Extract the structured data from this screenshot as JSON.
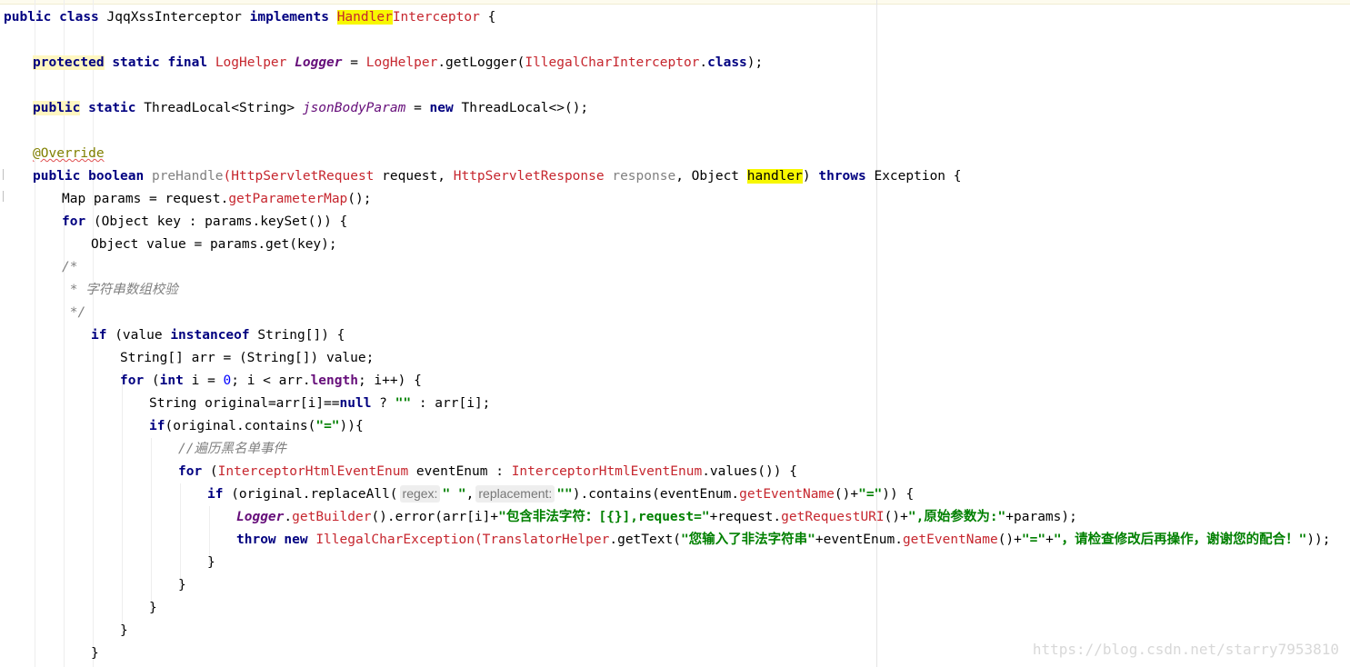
{
  "code": {
    "l1_public": "public",
    "l1_class": "class",
    "l1_classname": " JqqXssInterceptor ",
    "l1_implements": "implements",
    "l1_sp": " ",
    "l1_handler": "Handler",
    "l1_interceptor": "Interceptor",
    "l1_brace": " {",
    "l3_protected": "protected",
    "l3_static": "static",
    "l3_final": "final",
    "l3_type": "LogHelper",
    "l3_logger": "Logger",
    "l3_eq": " = ",
    "l3_loghelper": "LogHelper",
    "l3_getlogger": ".getLogger(",
    "l3_arg": "IllegalCharInterceptor",
    "l3_dot": ".",
    "l3_classkw": "class",
    "l3_end": ");",
    "l5_public": "public",
    "l5_static": "static",
    "l5_type": " ThreadLocal<String> ",
    "l5_field": "jsonBodyParam",
    "l5_eq": " = ",
    "l5_new": "new",
    "l5_rest": " ThreadLocal<>();",
    "l7_override": "@Override",
    "l8_public": "public",
    "l8_boolean": "boolean",
    "l8_method": "preHandle",
    "l8_paren": "(",
    "l8_t1": "HttpServletRequest",
    "l8_p1": " request, ",
    "l8_t2": "HttpServletResponse",
    "l8_p2": " response",
    "l8_p3": ", Object ",
    "l8_handler": "handler",
    "l8_close": ") ",
    "l8_throws": "throws",
    "l8_exc": " Exception {",
    "l9_a": "Map params = request.",
    "l9_b": "getParameterMap",
    "l9_c": "();",
    "l10_for": "for",
    "l10_rest": " (Object key : params.keySet()) {",
    "l11": "Object value = params.get(key);",
    "l12": "/*",
    "l13": " * 字符串数组校验",
    "l14": " */",
    "l15_if": "if",
    "l15_a": " (value ",
    "l15_instanceof": "instanceof",
    "l15_b": " String[]) {",
    "l16": "String[] arr = (String[]) value;",
    "l17_for": "for",
    "l17_a": " (",
    "l17_int": "int",
    "l17_b": " i = ",
    "l17_zero": "0",
    "l17_c": "; i < arr.",
    "l17_length": "length",
    "l17_d": "; i++) {",
    "l18_a": "String original=arr[i]==",
    "l18_null": "null",
    "l18_b": " ? ",
    "l18_str": "\"\"",
    "l18_c": " : arr[i];",
    "l19_if": "if",
    "l19_a": "(original.contains(",
    "l19_str": "\"=\"",
    "l19_b": ")){",
    "l20": "//遍历黑名单事件",
    "l21_for": "for",
    "l21_a": " (",
    "l21_t": "InterceptorHtmlEventEnum",
    "l21_b": " eventEnum : ",
    "l21_c": "InterceptorHtmlEventEnum",
    "l21_d": ".values()) {",
    "l22_if": "if",
    "l22_a": " (original.replaceAll(",
    "l22_hint1": "regex:",
    "l22_s1": "\" \"",
    "l22_comma": ",",
    "l22_hint2": "replacement:",
    "l22_s2": "\"\"",
    "l22_b": ").contains(eventEnum.",
    "l22_m": "getEventName",
    "l22_c": "()+",
    "l22_s3": "\"=\"",
    "l22_d": ")) {",
    "l23_logger": "Logger",
    "l23_dot": ".",
    "l23_getbuilder": "getBuilder",
    "l23_a": "().error(arr[i]+",
    "l23_s1": "\"包含非法字符：[{}],request=\"",
    "l23_b": "+request.",
    "l23_m": "getRequestURI",
    "l23_c": "()+",
    "l23_s2": "\",原始参数为:\"",
    "l23_d": "+params);",
    "l24_throw": "throw",
    "l24_new": "new",
    "l24_exc": "IllegalCharException",
    "l24_paren": "(",
    "l24_helper": "TranslatorHelper",
    "l24_a": ".getText(",
    "l24_s1": "\"您输入了非法字符串\"",
    "l24_b": "+eventEnum.",
    "l24_m": "getEventName",
    "l24_c": "()+",
    "l24_s2": "\"=\"",
    "l24_plus": "+",
    "l24_s3": "\"，请检查修改后再操作，谢谢您的配合！\"",
    "l24_end": "));",
    "brace": "}"
  },
  "watermark": "https://blog.csdn.net/starry7953810",
  "colors": {
    "keyword": "#000080",
    "type_ref": "#c6262e",
    "field": "#660e7a",
    "number": "#0000ff",
    "string": "#008000",
    "comment": "#808080",
    "annotation": "#808000",
    "highlight": "#f7f700"
  }
}
